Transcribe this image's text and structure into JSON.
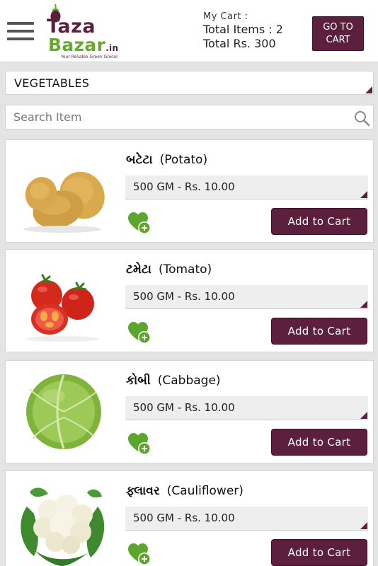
{
  "header": {
    "logo": {
      "line1": "Taza",
      "line2": "Bazar",
      "tld": ".in",
      "tagline": "Your Reliable Green Grocer"
    },
    "cart": {
      "title": "My Cart  :",
      "items_label": "Total Items :  2",
      "total_label": "Total Rs. 300"
    },
    "goto_cart_label_1": "GO TO",
    "goto_cart_label_2": "CART"
  },
  "category": {
    "selected": "VEGETABLES"
  },
  "search": {
    "placeholder": "Search Item"
  },
  "colors": {
    "accent": "#5d1f3e",
    "brand_green": "#6aa732",
    "background": "#e4e4e4"
  },
  "products": [
    {
      "name_gujarati": "બટેટા",
      "name_english": "(Potato)",
      "variant": "500 GM - Rs. 10.00",
      "add_label": "Add to Cart",
      "image": "potato"
    },
    {
      "name_gujarati": "ટમેટા",
      "name_english": "(Tomato)",
      "variant": "500 GM - Rs. 10.00",
      "add_label": "Add to Cart",
      "image": "tomato"
    },
    {
      "name_gujarati": "કોબી",
      "name_english": "(Cabbage)",
      "variant": "500 GM - Rs. 10.00",
      "add_label": "Add to Cart",
      "image": "cabbage"
    },
    {
      "name_gujarati": "ફ્લાવર",
      "name_english": "(Cauliflower)",
      "variant": "500 GM - Rs. 10.00",
      "add_label": "Add to Cart",
      "image": "cauliflower"
    }
  ]
}
